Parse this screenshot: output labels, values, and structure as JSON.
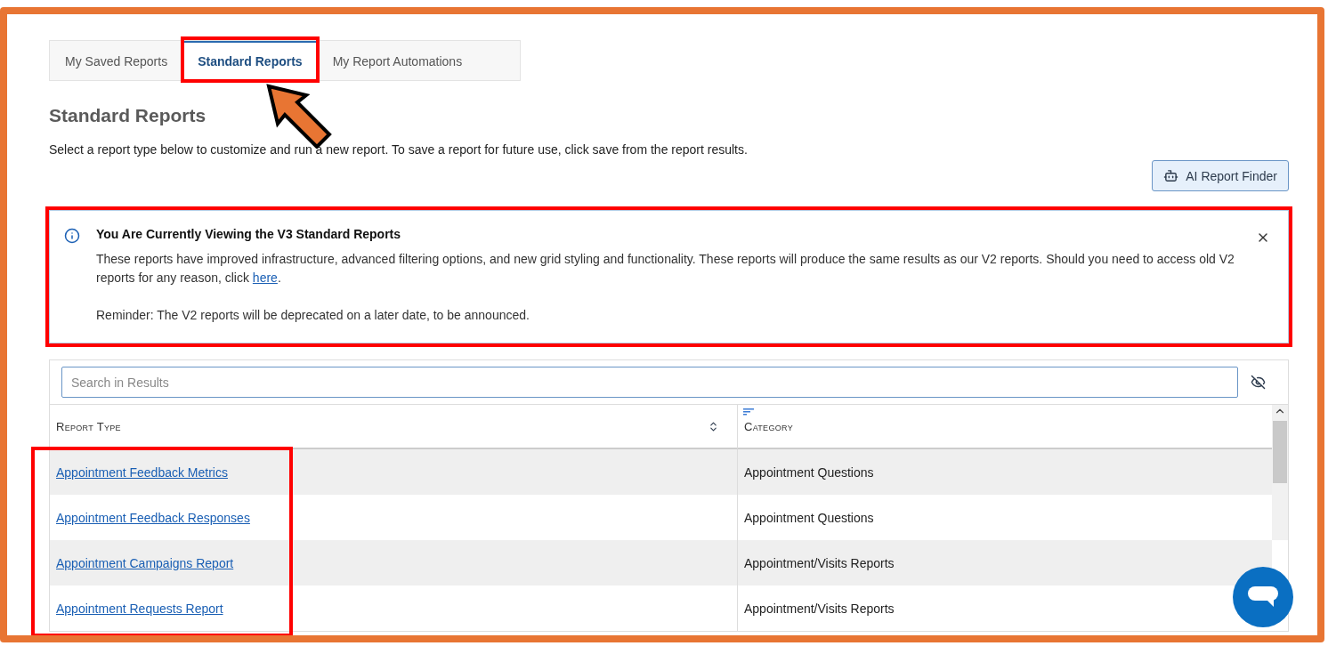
{
  "tabs": [
    {
      "label": "My Saved Reports",
      "selected": false
    },
    {
      "label": "Standard Reports",
      "selected": true
    },
    {
      "label": "My Report Automations",
      "selected": false
    }
  ],
  "heading": "Standard Reports",
  "description": "Select a report type below to customize and run a new report. To save a report for future use, click save from the report results.",
  "ai_button": {
    "label": "AI Report Finder"
  },
  "notice": {
    "title": "You Are Currently Viewing the V3 Standard Reports",
    "body": "These reports have improved infrastructure, advanced filtering options, and new grid styling and functionality. These reports will produce the same results as our V2 reports. Should you need to access old V2 reports for any reason, click ",
    "link": "here",
    "body_end": ".",
    "reminder": "Reminder: The V2 reports will be deprecated on a later date, to be announced."
  },
  "search": {
    "placeholder": "Search in Results"
  },
  "table": {
    "columns": [
      {
        "label": "Report Type",
        "kind": "updown"
      },
      {
        "label": "Category",
        "kind": "lines"
      }
    ],
    "rows": [
      {
        "report_type": "Appointment Feedback Metrics",
        "category": "Appointment Questions"
      },
      {
        "report_type": "Appointment Feedback Responses",
        "category": "Appointment Questions"
      },
      {
        "report_type": "Appointment Campaigns Report",
        "category": "Appointment/Visits Reports"
      },
      {
        "report_type": "Appointment Requests Report",
        "category": "Appointment/Visits Reports"
      }
    ]
  }
}
